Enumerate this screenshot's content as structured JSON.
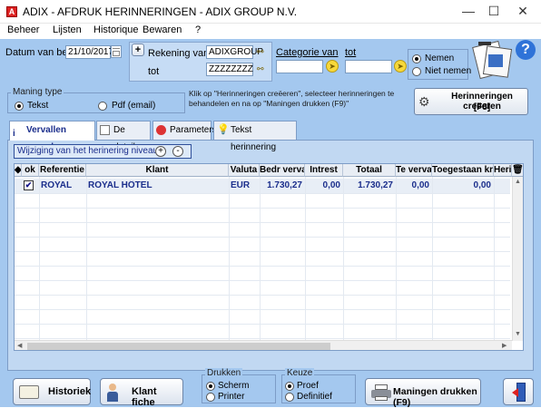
{
  "window": {
    "title": "ADIX - AFDRUK HERINNERINGEN - ADIX GROUP N.V.",
    "app_icon": "adix-app-icon",
    "minimize": "—",
    "maximize": "☐",
    "close": "✕"
  },
  "menu": [
    "Beheer",
    "Lijsten",
    "Historique",
    "Bewaren",
    "?"
  ],
  "filters": {
    "datum_label": "Datum van behee",
    "datum_value": "21/10/2017",
    "plus": "+",
    "rekening_van_label": "Rekening van",
    "rekening_van_value": "ADIXGROUP",
    "rekening_tot_label": "tot",
    "rekening_tot_value": "ZZZZZZZZ",
    "categorie_van_label": "Categorie van",
    "categorie_van_value": "",
    "categorie_tot_label": "tot",
    "categorie_tot_value": "",
    "nemen_label": "Nemen",
    "niet_nemen_label": "Niet nemen"
  },
  "maning_type": {
    "title": "Maning type",
    "tekst": "Tekst",
    "pdf": "Pdf (email)"
  },
  "instruction": "Klik op \"Herinneringen creëeren\", selecteer herinneringen te behandelen en na op \"Maningen drukken (F9)\"",
  "create_button": {
    "line1": "Herinneringen creëeren",
    "line2": "[F8]"
  },
  "tabs": [
    "Vervallen rappel",
    "De details",
    "Parameters",
    "Tekst herinnering"
  ],
  "level_bar": {
    "label": "Wijziging van het herinering niveau",
    "plus": "+",
    "minus": "-"
  },
  "grid": {
    "columns": [
      "ok",
      "Referentie",
      "Klant",
      "Valuta",
      "Bedr verva",
      "Intrest",
      "Totaal",
      "Te verval",
      "Toegestaan kre",
      "Herir"
    ],
    "rows": [
      {
        "ok": "✔",
        "referentie": "ROYAL",
        "klant": "ROYAL HÔTEL",
        "valuta": "EUR",
        "bedr_verva": "1.730,27",
        "intrest": "0,00",
        "totaal": "1.730,27",
        "te_verval": "0,00",
        "toegestaan": "0,00",
        "herir": ""
      }
    ]
  },
  "drukken": {
    "title": "Drukken",
    "scherm": "Scherm",
    "printer": "Printer"
  },
  "keuze": {
    "title": "Keuze",
    "proef": "Proef",
    "definitief": "Definitief"
  },
  "bottom_buttons": {
    "historiek": "Historiek",
    "klant_fiche": "Klant fiche",
    "maningen": "Maningen drukken (F9)"
  },
  "colors": {
    "background": "#a4c8ef",
    "accent_text": "#1b2e8c",
    "row_highlight": "#e8eef6"
  }
}
